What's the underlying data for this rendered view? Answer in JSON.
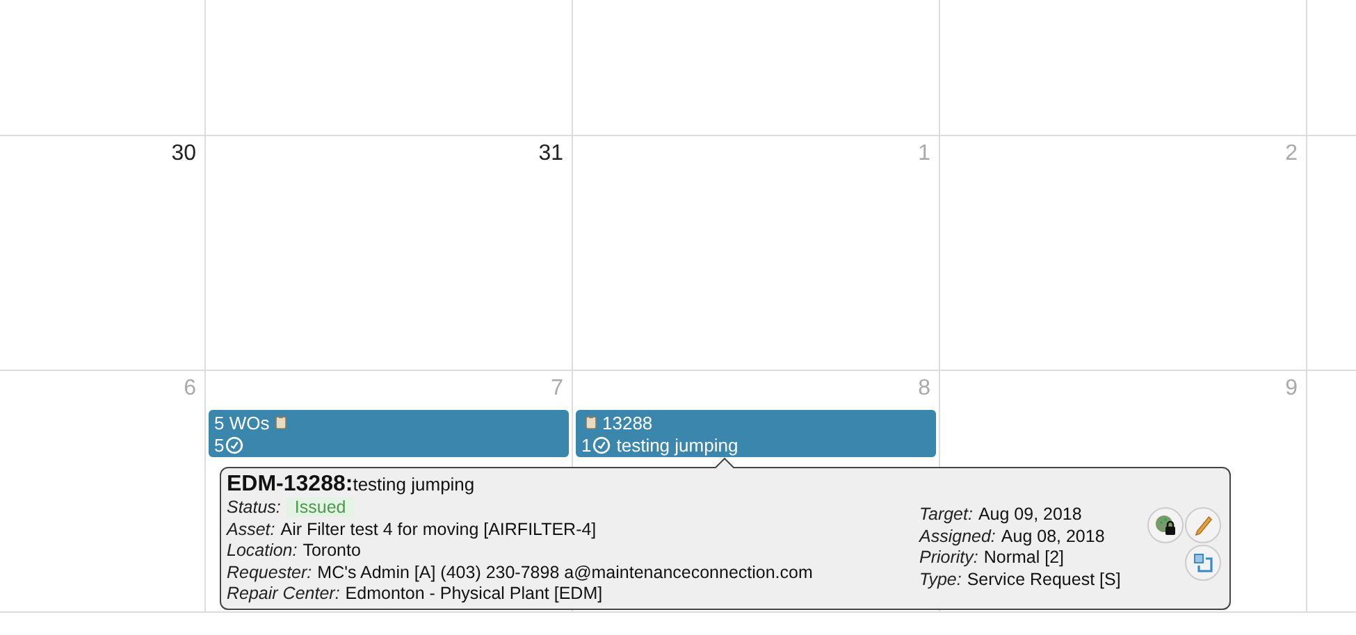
{
  "weeks": [
    {
      "days": [
        {
          "number": "30",
          "dimmed": false
        },
        {
          "number": "31",
          "dimmed": false
        },
        {
          "number": "1",
          "dimmed": true
        },
        {
          "number": "2",
          "dimmed": true
        }
      ]
    },
    {
      "days": [
        {
          "number": "6",
          "dimmed": true
        },
        {
          "number": "7",
          "dimmed": true,
          "events": [
            {
              "title": "5 WOs",
              "count": "5",
              "icon_first": false
            }
          ]
        },
        {
          "number": "8",
          "dimmed": true,
          "events": [
            {
              "title": "13288",
              "count": "1",
              "subtitle": "testing jumping",
              "icon_first": true
            }
          ]
        },
        {
          "number": "9",
          "dimmed": true
        }
      ]
    }
  ],
  "popup": {
    "code": "EDM-13288:",
    "title": "testing jumping",
    "left": [
      {
        "label": "Status:",
        "value": "Issued",
        "kind": "status"
      },
      {
        "label": "Asset:",
        "value": "Air Filter test 4 for moving [AIRFILTER-4]",
        "kind": "text"
      },
      {
        "label": "Location:",
        "value": "Toronto",
        "kind": "text"
      },
      {
        "label": "Requester:",
        "value": "MC's Admin [A] (403) 230-7898 a@maintenanceconnection.com",
        "kind": "text"
      },
      {
        "label": "Repair Center:",
        "value": "Edmonton - Physical Plant [EDM]",
        "kind": "text"
      }
    ],
    "right": [
      {
        "label": "Target:",
        "value": "Aug 09, 2018",
        "kind": "text"
      },
      {
        "label": "Assigned:",
        "value": "Aug 08, 2018",
        "kind": "text"
      },
      {
        "label": "Priority:",
        "value": "Normal [2]",
        "kind": "text"
      },
      {
        "label": "Type:",
        "value": "Service Request [S]",
        "kind": "text"
      }
    ]
  }
}
